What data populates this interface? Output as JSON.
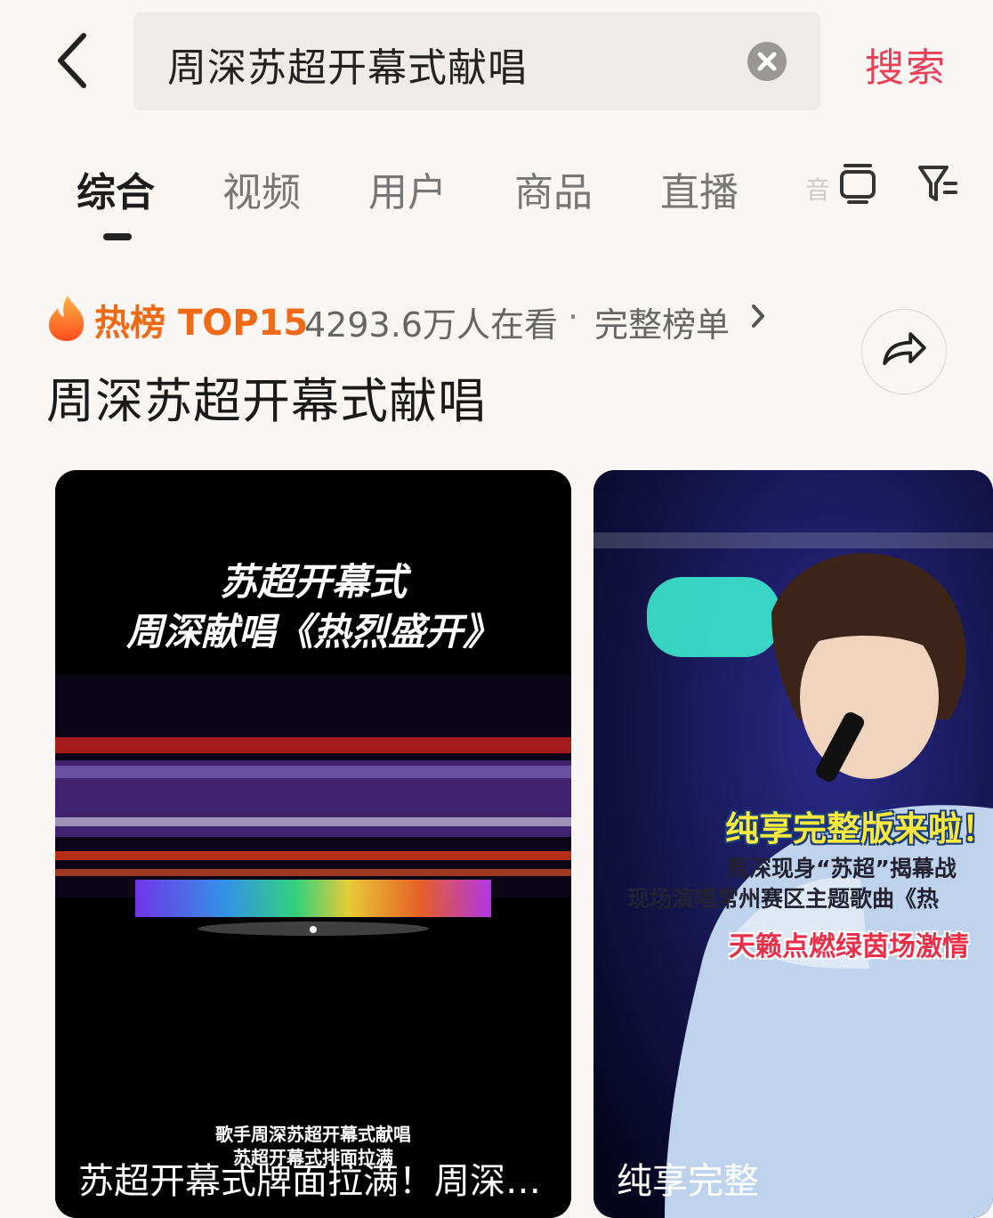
{
  "search": {
    "query": "周深苏超开幕式献唱",
    "submit_label": "搜索"
  },
  "tabs": [
    {
      "label": "综合",
      "active": true
    },
    {
      "label": "视频"
    },
    {
      "label": "用户"
    },
    {
      "label": "商品"
    },
    {
      "label": "直播"
    }
  ],
  "tabs_overflow_glyph": "音",
  "hot": {
    "label": "热榜",
    "rank_label": "TOP15",
    "viewers": "4293.6万人在看",
    "separator": "·",
    "full_list_label": "完整榜单"
  },
  "topic_title": "周深苏超开幕式献唱",
  "cards": [
    {
      "overlay_line1": "苏超开幕式",
      "overlay_line2": "周深献唱《热烈盛开》",
      "small_caption1": "歌手周深苏超开幕式献唱",
      "small_caption2": "苏超开幕式排面拉满",
      "caption": "苏超开幕式牌面拉满！周深…"
    },
    {
      "promo_line1": "纯享完整版来啦！",
      "promo_line2": "周深现身“苏超”揭幕战",
      "promo_line3": "现场演唱常州赛区主题歌曲《热",
      "promo_line4": "天籁点燃绿茵场激情",
      "caption": "纯享完整"
    }
  ],
  "icons": [
    "back-arrow-icon",
    "clear-icon",
    "tv-icon",
    "filter-icon",
    "flame-icon",
    "chevron-right-icon",
    "share-icon"
  ],
  "colors": {
    "accent": "#e8405a",
    "hot": "#ef6a16",
    "background": "#faf6f3"
  }
}
